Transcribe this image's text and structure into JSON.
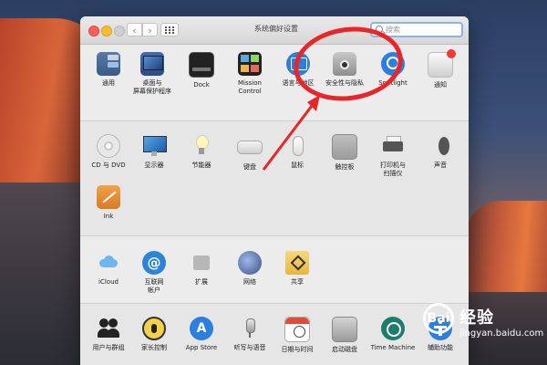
{
  "window": {
    "title": "系统偏好设置"
  },
  "search": {
    "placeholder": "搜索"
  },
  "sections": {
    "personal": [
      {
        "label": "通用"
      },
      {
        "label": "桌面与\n屏幕保护程序"
      },
      {
        "label": "Dock"
      },
      {
        "label": "Mission\nControl"
      },
      {
        "label": "语言与地区"
      },
      {
        "label": "安全性与隐私"
      },
      {
        "label": "Spotlight"
      },
      {
        "label": "通知"
      }
    ],
    "hardware": [
      {
        "label": "CD 与 DVD"
      },
      {
        "label": "显示器"
      },
      {
        "label": "节能器"
      },
      {
        "label": "键盘"
      },
      {
        "label": "鼠标"
      },
      {
        "label": "触控板"
      },
      {
        "label": "打印机与\n扫描仪"
      },
      {
        "label": "声音"
      },
      {
        "label": "Ink"
      }
    ],
    "internet": [
      {
        "label": "iCloud"
      },
      {
        "label": "互联网\n帐户"
      },
      {
        "label": "扩展"
      },
      {
        "label": "网络"
      },
      {
        "label": "共享"
      }
    ],
    "system": [
      {
        "label": "用户与群组"
      },
      {
        "label": "家长控制"
      },
      {
        "label": "App Store"
      },
      {
        "label": "听写与语音"
      },
      {
        "label": "日期与时间"
      },
      {
        "label": "启动磁盘"
      },
      {
        "label": "Time Machine"
      },
      {
        "label": "辅助功能"
      }
    ]
  },
  "icon_text": {
    "general_tile_1": "File",
    "general_tile_2": "New",
    "internet": "@",
    "appstore": "A"
  },
  "watermark": {
    "logo": "Bai",
    "text": "经验",
    "sub": "jingyan.baidu.com"
  },
  "colors": {
    "annotation": "#e8262a",
    "search_focus": "#8ab4ea"
  }
}
